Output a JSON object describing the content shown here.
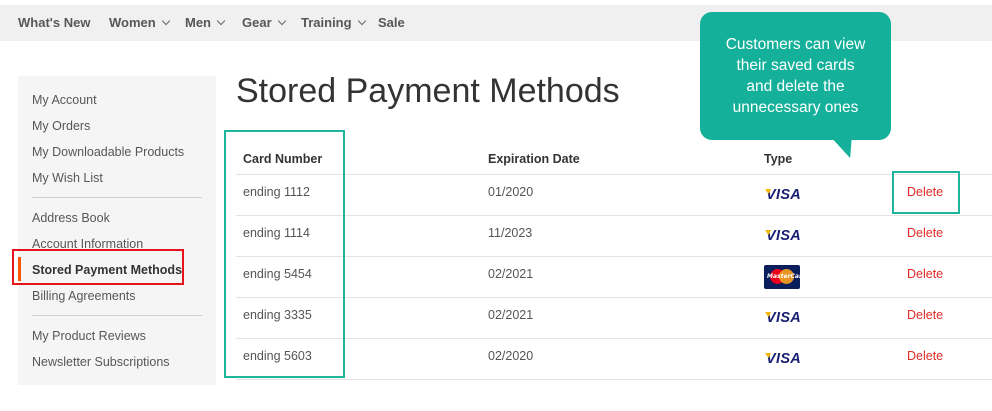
{
  "nav": {
    "items": [
      {
        "label": "What's New",
        "has_dropdown": false
      },
      {
        "label": "Women",
        "has_dropdown": true
      },
      {
        "label": "Men",
        "has_dropdown": true
      },
      {
        "label": "Gear",
        "has_dropdown": true
      },
      {
        "label": "Training",
        "has_dropdown": true
      },
      {
        "label": "Sale",
        "has_dropdown": false
      }
    ]
  },
  "sidebar": {
    "items": [
      {
        "label": "My Account"
      },
      {
        "label": "My Orders"
      },
      {
        "label": "My Downloadable Products"
      },
      {
        "label": "My Wish List"
      },
      {
        "label": "Address Book"
      },
      {
        "label": "Account Information"
      },
      {
        "label": "Stored Payment Methods",
        "active": true
      },
      {
        "label": "Billing Agreements"
      },
      {
        "label": "My Product Reviews"
      },
      {
        "label": "Newsletter Subscriptions"
      }
    ],
    "active_color": "#ff5501"
  },
  "main": {
    "title": "Stored Payment Methods",
    "table": {
      "headers": [
        "Card Number",
        "Expiration Date",
        "Type"
      ],
      "rows": [
        {
          "card": "ending 1112",
          "expiration": "01/2020",
          "type": "VISA",
          "action": "Delete"
        },
        {
          "card": "ending 1114",
          "expiration": "11/2023",
          "type": "VISA",
          "action": "Delete"
        },
        {
          "card": "ending 5454",
          "expiration": "02/2021",
          "type": "MasterCard",
          "action": "Delete"
        },
        {
          "card": "ending 3335",
          "expiration": "02/2021",
          "type": "VISA",
          "action": "Delete"
        },
        {
          "card": "ending 5603",
          "expiration": "02/2020",
          "type": "VISA",
          "action": "Delete"
        }
      ]
    }
  },
  "annotation": {
    "bubble_lines": [
      "Customers can view",
      "their saved cards",
      "and delete the",
      "unnecessary ones"
    ],
    "bubble_color": "#14b09a",
    "highlight_color": "#1fb69d",
    "active_highlight_color": "#e8121c"
  },
  "colors": {
    "delete": "#e02b27",
    "visa_blue": "#1a1f71"
  }
}
